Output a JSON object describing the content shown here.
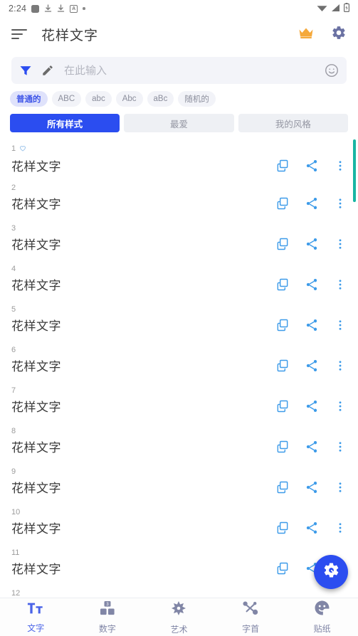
{
  "statusbar": {
    "time": "2:24",
    "left_icons": [
      "app-square-icon",
      "download-icon",
      "download-icon",
      "screenshot-icon",
      "more-dot-icon"
    ],
    "right_icons": [
      "wifi-icon",
      "signal-icon",
      "battery-icon"
    ]
  },
  "appbar": {
    "menu_icon": "hamburger-sort-icon",
    "title": "花样文字",
    "crown_icon": "crown-icon",
    "gear_icon": "gear-icon",
    "crown_color": "#f5a93b",
    "gear_color": "#6b72a3"
  },
  "search": {
    "filter_icon": "filter-funnel-icon",
    "pencil_icon": "pencil-icon",
    "placeholder": "在此输入",
    "value": "",
    "emoji_icon": "smiley-icon"
  },
  "chips": [
    {
      "label": "普通的",
      "active": true
    },
    {
      "label": "ABC",
      "active": false
    },
    {
      "label": "abc",
      "active": false
    },
    {
      "label": "Abc",
      "active": false
    },
    {
      "label": "aBc",
      "active": false
    },
    {
      "label": "随机的",
      "active": false
    }
  ],
  "tabs": [
    {
      "label": "所有样式",
      "active": true
    },
    {
      "label": "最爱",
      "active": false
    },
    {
      "label": "我的风格",
      "active": false
    }
  ],
  "list": {
    "row_actions": [
      "copy-icon",
      "share-icon",
      "overflow-menu-icon"
    ],
    "rows": [
      {
        "num": "1",
        "text": "花样文字",
        "favorited": true
      },
      {
        "num": "2",
        "text": "花样文字",
        "favorited": false
      },
      {
        "num": "3",
        "text": "花样文字",
        "favorited": false
      },
      {
        "num": "4",
        "text": "花样文字",
        "favorited": false
      },
      {
        "num": "5",
        "text": "花样文字",
        "favorited": false
      },
      {
        "num": "6",
        "text": "花样文字",
        "favorited": false
      },
      {
        "num": "7",
        "text": "花样文字",
        "favorited": false
      },
      {
        "num": "8",
        "text": "花样文字",
        "favorited": false
      },
      {
        "num": "9",
        "text": "花样文字",
        "favorited": false
      },
      {
        "num": "10",
        "text": "花样文字",
        "favorited": false
      },
      {
        "num": "11",
        "text": "花样文字",
        "favorited": false
      },
      {
        "num": "12",
        "text": "",
        "favorited": false
      }
    ]
  },
  "scrollbar": {
    "color": "#18b5a3"
  },
  "fab": {
    "icon": "settings-gear-icon",
    "color": "#2b4df0"
  },
  "bottomnav": [
    {
      "label": "文字",
      "icon": "text-tt-icon",
      "active": true
    },
    {
      "label": "数字",
      "icon": "number-blocks-icon",
      "active": false
    },
    {
      "label": "艺术",
      "icon": "art-flower-icon",
      "active": false
    },
    {
      "label": "字首",
      "icon": "initials-icon",
      "active": false
    },
    {
      "label": "贴纸",
      "icon": "sticker-smiley-icon",
      "active": false
    }
  ],
  "colors": {
    "accent": "#2b4df0",
    "chip_active_bg": "#dfe2fb",
    "row_icon": "#3d9be9",
    "scrollbar": "#18b5a3"
  }
}
